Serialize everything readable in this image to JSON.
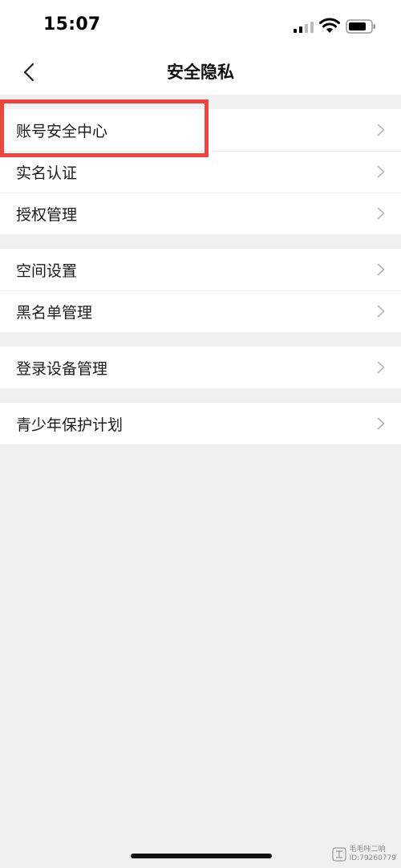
{
  "status_bar": {
    "time": "15:07"
  },
  "nav": {
    "title": "安全隐私",
    "back_icon": "chevron-left-icon"
  },
  "groups": [
    {
      "items": [
        {
          "label": "账号安全中心"
        },
        {
          "label": "实名认证"
        },
        {
          "label": "授权管理"
        }
      ]
    },
    {
      "items": [
        {
          "label": "空间设置"
        },
        {
          "label": "黑名单管理"
        }
      ]
    },
    {
      "items": [
        {
          "label": "登录设备管理"
        }
      ]
    },
    {
      "items": [
        {
          "label": "青少年保护计划"
        }
      ]
    }
  ],
  "annotation": {
    "highlight_color": "#e9473f"
  },
  "watermark": {
    "line1": "毛毛咔二响",
    "line2": "ID:79260779"
  }
}
